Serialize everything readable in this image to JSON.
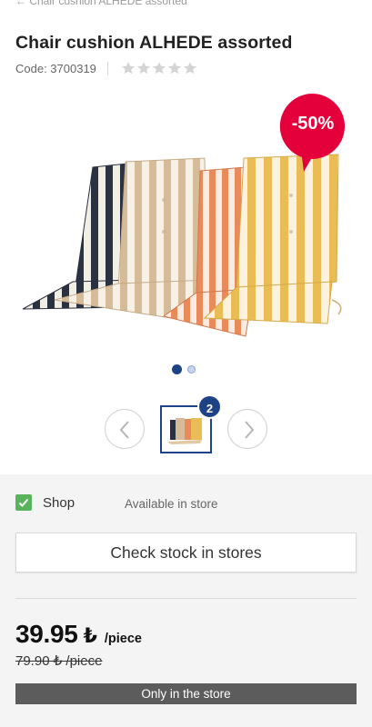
{
  "breadcrumb": "← Chair cushion ALHEDE assorted",
  "product": {
    "title": "Chair cushion ALHEDE assorted",
    "code_label": "Code: 3700319",
    "rating_stars": 0,
    "rating_max": 5,
    "discount_badge": "-50%",
    "image_count": "2"
  },
  "availability": {
    "shop_label": "Shop",
    "status_text": "Available in store",
    "check_stock_label": "Check stock in stores"
  },
  "pricing": {
    "price": "39.95",
    "currency_symbol": "₺",
    "unit": "/piece",
    "old_price": "79.90 ₺ /piece",
    "store_only_label": "Only in the store"
  },
  "colors": {
    "brand_blue": "#1d4386",
    "discount_red": "#e4003a",
    "check_green": "#59b35a",
    "bar_gray": "#5c5c5c"
  },
  "icons": [
    "star-icon",
    "chevron-left-icon",
    "chevron-right-icon",
    "checkbox-checked-icon"
  ]
}
